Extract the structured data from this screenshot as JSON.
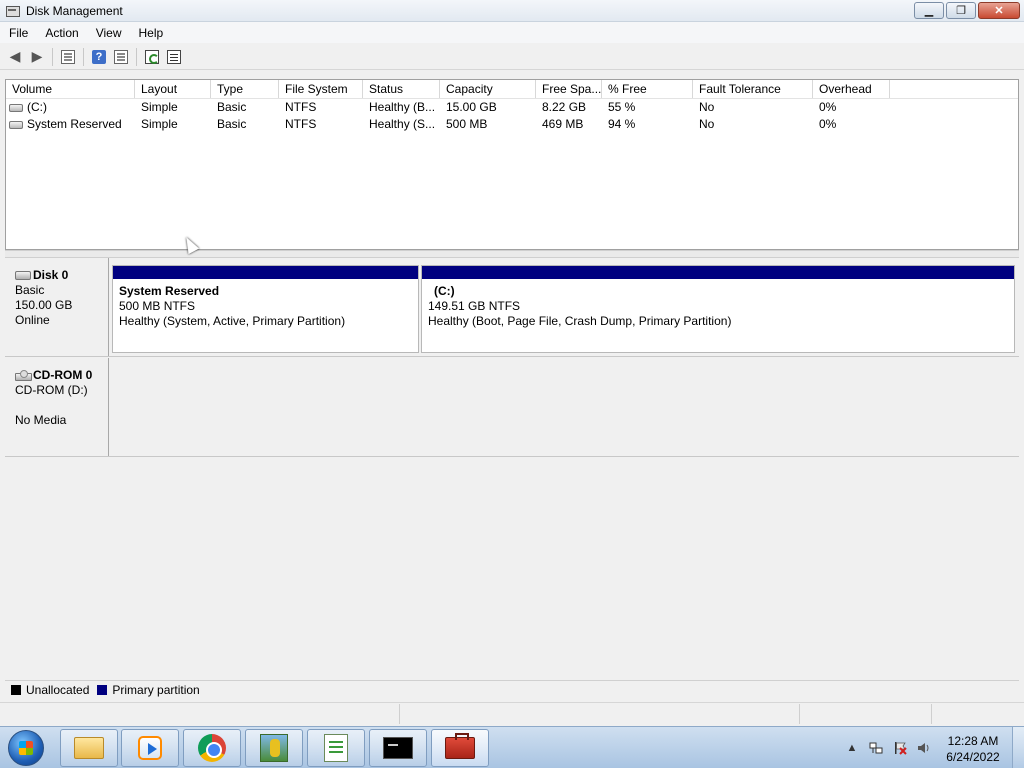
{
  "window": {
    "title": "Disk Management",
    "minimize": "▁",
    "maximize": "❐",
    "close": "✕"
  },
  "menu": [
    "File",
    "Action",
    "View",
    "Help"
  ],
  "toolbar": {
    "back": "◀",
    "forward": "▶",
    "help": "?"
  },
  "volumes": {
    "columns": [
      "Volume",
      "Layout",
      "Type",
      "File System",
      "Status",
      "Capacity",
      "Free Spa...",
      "% Free",
      "Fault Tolerance",
      "Overhead"
    ],
    "rows": [
      [
        "(C:)",
        "Simple",
        "Basic",
        "NTFS",
        "Healthy (B...",
        "15.00 GB",
        "8.22 GB",
        "55 %",
        "No",
        "0%"
      ],
      [
        "System Reserved",
        "Simple",
        "Basic",
        "NTFS",
        "Healthy (S...",
        "500 MB",
        "469 MB",
        "94 %",
        "No",
        "0%"
      ]
    ]
  },
  "disks": [
    {
      "name": "Disk 0",
      "type": "Basic",
      "size": "150.00 GB",
      "state": "Online",
      "partitions": [
        {
          "name": "System Reserved",
          "size": "500 MB NTFS",
          "status": "Healthy (System, Active, Primary Partition)"
        },
        {
          "name": "(C:)",
          "size": "149.51 GB NTFS",
          "status": "Healthy (Boot, Page File, Crash Dump, Primary Partition)"
        }
      ]
    },
    {
      "name": "CD-ROM 0",
      "type": "CD-ROM (D:)",
      "size": "",
      "state": "No Media"
    }
  ],
  "legend": [
    {
      "label": "Unallocated",
      "color": "#000000"
    },
    {
      "label": "Primary partition",
      "color": "#000080"
    }
  ],
  "tray": {
    "time": "12:28 AM",
    "date": "6/24/2022",
    "arrow": "▲"
  }
}
